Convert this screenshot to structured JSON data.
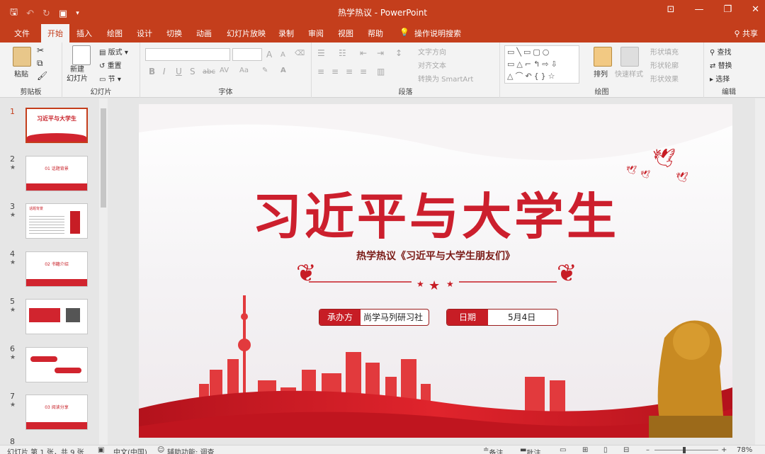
{
  "window": {
    "title": "热学热议  -  PowerPoint"
  },
  "tabs": [
    "文件",
    "开始",
    "插入",
    "绘图",
    "设计",
    "切换",
    "动画",
    "幻灯片放映",
    "录制",
    "审阅",
    "视图",
    "帮助"
  ],
  "tab_active": "开始",
  "search_label": "操作说明搜索",
  "share_label": "共享",
  "ribbon": {
    "clipboard": {
      "paste": "粘贴",
      "group": "剪贴板"
    },
    "slides": {
      "new_slide": "新建\n幻灯片",
      "layout": "版式",
      "reset": "重置",
      "section": "节",
      "group": "幻灯片"
    },
    "font": {
      "group": "字体",
      "bold": "B",
      "italic": "I",
      "underline": "U",
      "shadow": "S",
      "strike": "abc",
      "spacing": "AV",
      "case": "Aa",
      "grow": "A",
      "shrink": "A"
    },
    "paragraph": {
      "group": "段落",
      "text_dir": "文字方向",
      "align_text": "对齐文本",
      "smartart": "转换为 SmartArt"
    },
    "drawing": {
      "group": "绘图",
      "arrange": "排列",
      "quick_styles": "快速样式",
      "fill": "形状填充",
      "outline": "形状轮廓",
      "effects": "形状效果"
    },
    "editing": {
      "group": "编辑",
      "find": "查找",
      "replace": "替换",
      "select": "选择"
    }
  },
  "thumbnails": [
    {
      "num": "1",
      "text": "习近平与大学生"
    },
    {
      "num": "2",
      "text": "01 话题背景"
    },
    {
      "num": "3",
      "text": "话题背景"
    },
    {
      "num": "4",
      "text": "02 书籍介绍"
    },
    {
      "num": "5",
      "text": ""
    },
    {
      "num": "6",
      "text": ""
    },
    {
      "num": "7",
      "text": "03 阅读分享"
    },
    {
      "num": "8",
      "text": ""
    }
  ],
  "slide": {
    "title": "习近平与大学生",
    "subtitle": "热学热议《习近平与大学生朋友们》",
    "organizer_label": "承办方",
    "organizer_value": "尚学马列研习社",
    "date_label": "日期",
    "date_value": "5月4日"
  },
  "status": {
    "slide_info": "幻灯片 第 1 张，共 9 张",
    "language": "中文(中国)",
    "accessibility": "辅助功能: 调查",
    "notes": "备注",
    "comments": "批注",
    "zoom": "78%"
  },
  "colors": {
    "accent": "#c43e1c",
    "slide_red": "#cc1f2d"
  }
}
